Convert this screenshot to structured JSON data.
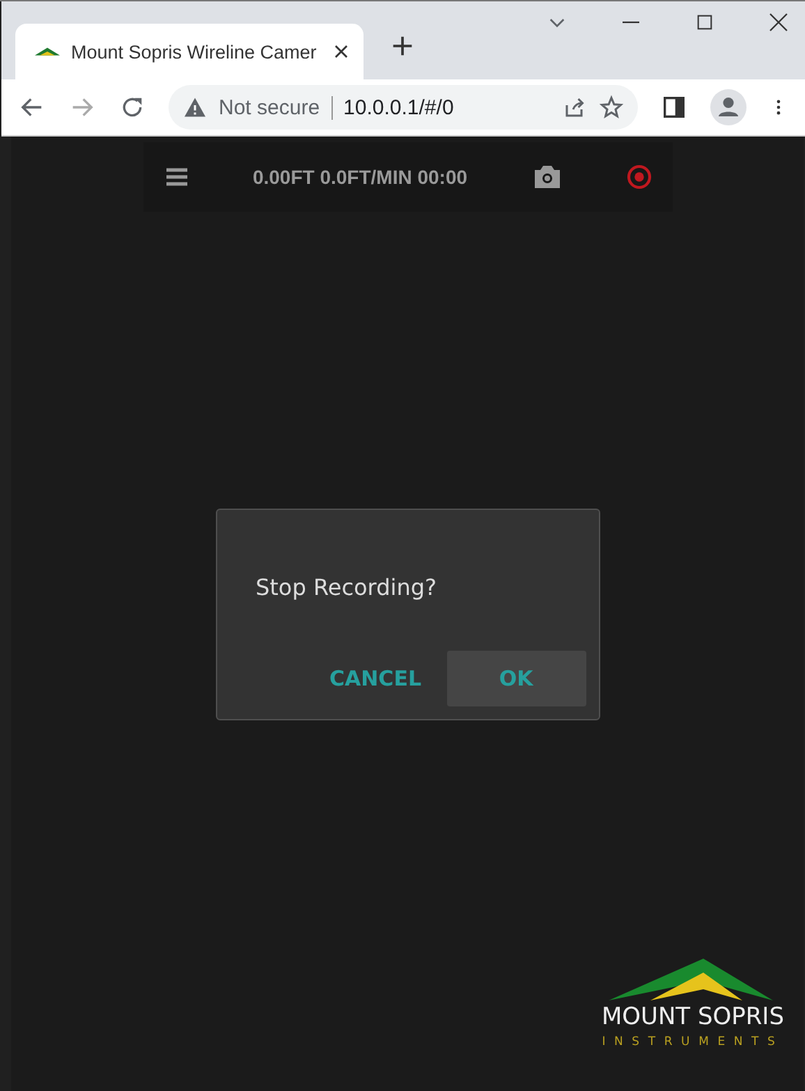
{
  "browser": {
    "tab_title": "Mount Sopris Wireline Camer",
    "security_label": "Not secure",
    "url": "10.0.0.1/#/0"
  },
  "toolbar": {
    "status": "0.00FT 0.0FT/MIN 00:00",
    "recording": true
  },
  "dialog": {
    "message": "Stop Recording?",
    "buttons": [
      {
        "label": "CANCEL",
        "kind": "flat"
      },
      {
        "label": "OK",
        "kind": "raised"
      }
    ]
  },
  "logo": {
    "name": "MOUNT SOPRIS",
    "tagline": "INSTRUMENTS"
  }
}
